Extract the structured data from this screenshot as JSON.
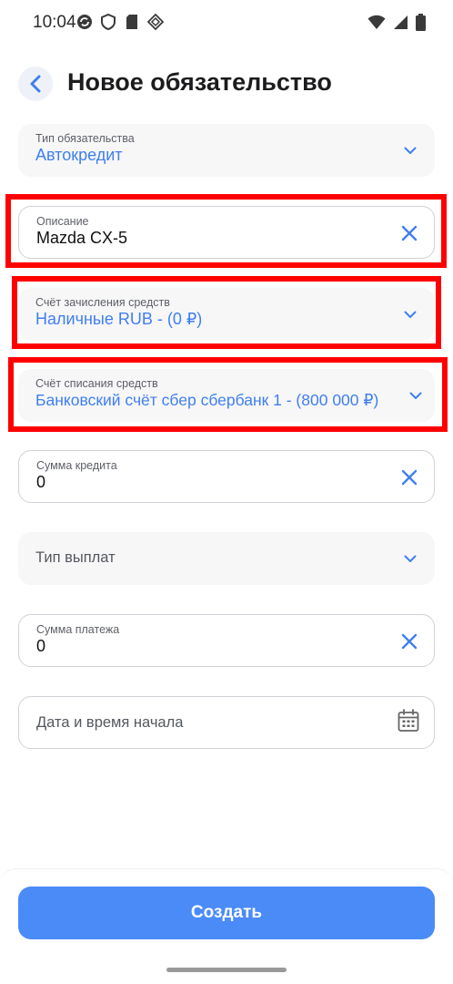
{
  "status_bar": {
    "time": "10:04"
  },
  "header": {
    "title": "Новое обязательство"
  },
  "form": {
    "type": {
      "label": "Тип обязательства",
      "value": "Автокредит"
    },
    "description": {
      "label": "Описание",
      "value": "Mazda CX-5"
    },
    "credit_account": {
      "label": "Счёт зачисления средств",
      "value": "Наличные RUB - (0 ₽)"
    },
    "debit_account": {
      "label": "Счёт списания средств",
      "value": "Банковский счёт сбер сбербанк 1 - (800 000 ₽)"
    },
    "loan_amount": {
      "label": "Сумма кредита",
      "value": "0"
    },
    "payment_type": {
      "placeholder": "Тип выплат"
    },
    "payment_amount": {
      "label": "Сумма платежа",
      "value": "0"
    },
    "start_date": {
      "placeholder": "Дата и время начала"
    }
  },
  "actions": {
    "create_label": "Создать"
  },
  "colors": {
    "accent": "#4b8bf8",
    "value_blue": "#3f7ff0",
    "highlight": "#ff0000"
  }
}
